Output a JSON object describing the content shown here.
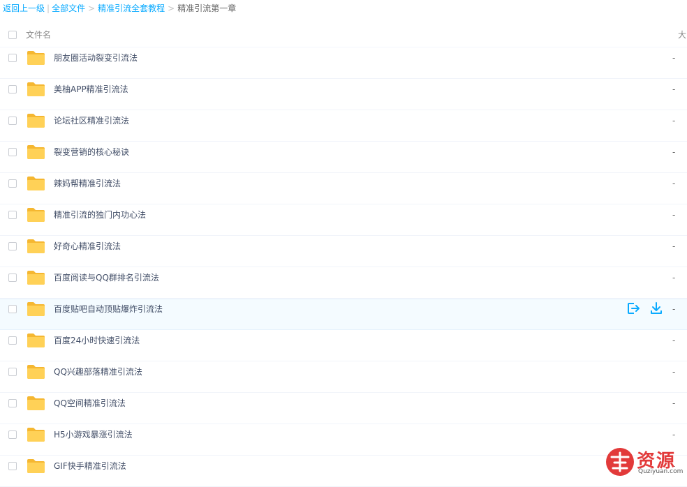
{
  "breadcrumb": {
    "back": "返回上一级",
    "all_files": "全部文件",
    "parent": "精准引流全套教程",
    "current": "精准引流第一章"
  },
  "header": {
    "name_col": "文件名",
    "size_col": "大"
  },
  "files": [
    {
      "name": "朋友圈活动裂变引流法",
      "size": "-"
    },
    {
      "name": "美柚APP精准引流法",
      "size": "-"
    },
    {
      "name": "论坛社区精准引流法",
      "size": "-"
    },
    {
      "name": "裂变营销的核心秘诀",
      "size": "-"
    },
    {
      "name": "辣妈帮精准引流法",
      "size": "-"
    },
    {
      "name": "精准引流的独门内功心法",
      "size": "-"
    },
    {
      "name": "好奇心精准引流法",
      "size": "-"
    },
    {
      "name": "百度阅读与QQ群排名引流法",
      "size": "-"
    },
    {
      "name": "百度贴吧自动顶贴爆炸引流法",
      "size": "-"
    },
    {
      "name": "百度24小时快速引流法",
      "size": "-"
    },
    {
      "name": "QQ兴趣部落精准引流法",
      "size": "-"
    },
    {
      "name": "QQ空间精准引流法",
      "size": "-"
    },
    {
      "name": "H5小游戏暴涨引流法",
      "size": "-"
    },
    {
      "name": "GIF快手精准引流法",
      "size": "-"
    }
  ],
  "icons": {
    "folder": "folder-icon",
    "share": "share-icon",
    "download": "download-icon",
    "checkbox": "checkbox"
  },
  "colors": {
    "accent": "#09aaff",
    "folder": "#ffd157",
    "hover_row": "#f4fbff",
    "watermark": "#e23a3a"
  },
  "watermark": {
    "text": "资源",
    "domain": "Quziyuan.com"
  }
}
